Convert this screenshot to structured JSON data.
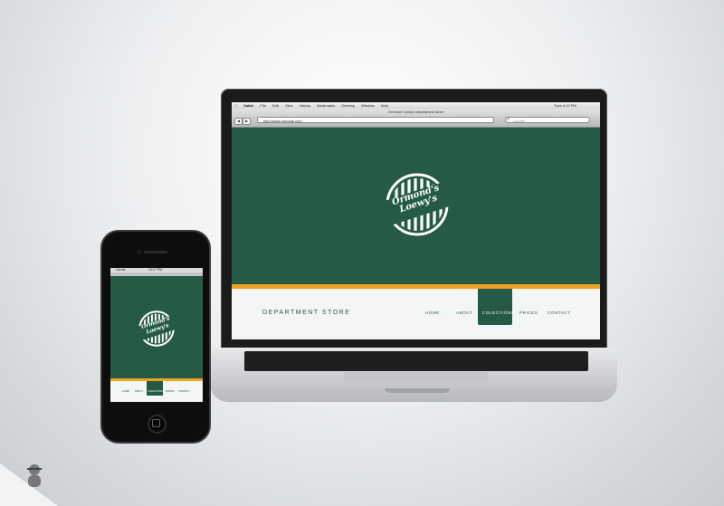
{
  "browser": {
    "app_name": "Safari",
    "menu_items": [
      "File",
      "Edit",
      "View",
      "History",
      "Bookmarks",
      "Develop",
      "Window",
      "Help"
    ],
    "status_time": "Tues 4:17 PM",
    "window_title": "Ormond Loewy's department store",
    "url": "http://www.ormondl.com",
    "search_placeholder": "Google"
  },
  "site": {
    "brand": "DEPARTMENT STORE",
    "nav": [
      "HOME.",
      "ABOUT",
      "COLECTIONS",
      "PRICES",
      "CONTACT"
    ],
    "active_nav": "COLECTIONS",
    "logo_text": "Ormond's Loewy's"
  },
  "phone": {
    "carrier": "Carrier",
    "time": "10:17 PM",
    "nav": [
      "HOME",
      "ABOUT",
      "COLECTIONS",
      "PRICES",
      "CONTACT"
    ]
  },
  "colors": {
    "brand_green": "#255b44",
    "accent_orange": "#f0a21e"
  }
}
